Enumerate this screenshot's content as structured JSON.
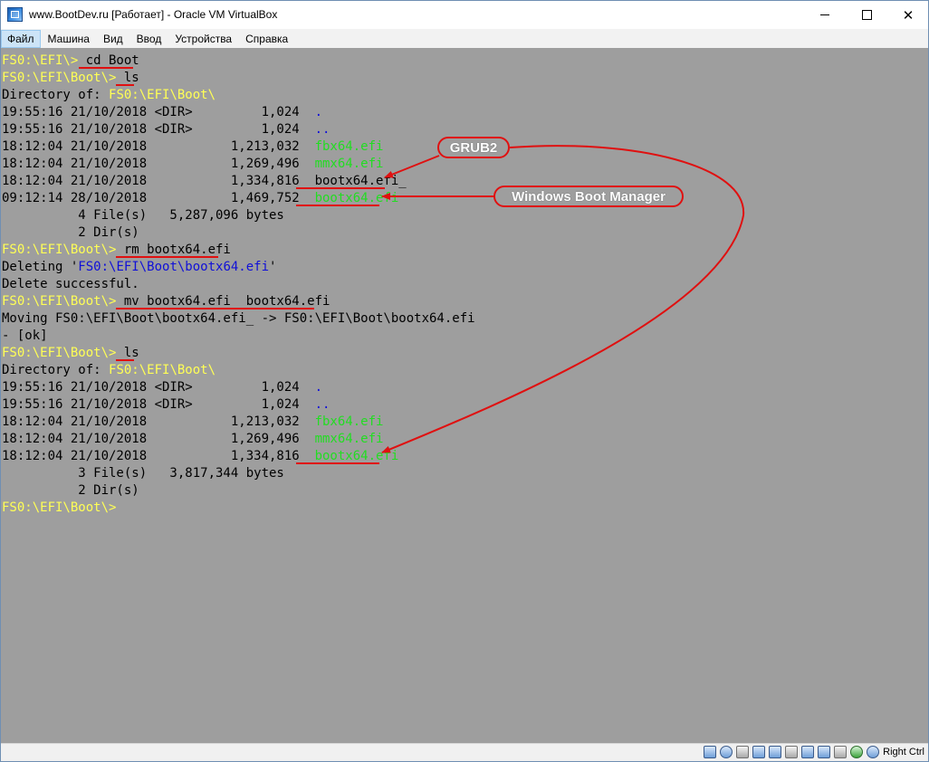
{
  "window": {
    "title": "www.BootDev.ru [Работает] - Oracle VM VirtualBox",
    "controls": {
      "minimize": "—",
      "maximize": "☐",
      "close": "✕"
    }
  },
  "menu": [
    {
      "label": "Файл",
      "active": true
    },
    {
      "label": "Машина"
    },
    {
      "label": "Вид"
    },
    {
      "label": "Ввод"
    },
    {
      "label": "Устройства"
    },
    {
      "label": "Справка"
    }
  ],
  "console": {
    "lines": [
      [
        [
          "FS0:\\EFI\\> ",
          "prompt"
        ],
        [
          "cd Boot",
          "black"
        ]
      ],
      [
        [
          "FS0:\\EFI\\Boot\\> ",
          "prompt"
        ],
        [
          "ls",
          "black"
        ]
      ],
      [
        [
          "Directory of: ",
          "black"
        ],
        [
          "FS0:\\EFI\\Boot\\",
          "prompt"
        ]
      ],
      [
        [
          "19:55:16 21/10/2018 <DIR>         1,024  ",
          "black"
        ],
        [
          ".",
          "blue"
        ]
      ],
      [
        [
          "19:55:16 21/10/2018 <DIR>         1,024  ",
          "black"
        ],
        [
          "..",
          "blue"
        ]
      ],
      [
        [
          "18:12:04 21/10/2018           1,213,032  ",
          "black"
        ],
        [
          "fbx64.efi",
          "green"
        ]
      ],
      [
        [
          "18:12:04 21/10/2018           1,269,496  ",
          "black"
        ],
        [
          "mmx64.efi",
          "green"
        ]
      ],
      [
        [
          "18:12:04 21/10/2018           1,334,816  ",
          "black"
        ],
        [
          "bootx64.efi_",
          "black"
        ]
      ],
      [
        [
          "09:12:14 28/10/2018           1,469,752  ",
          "black"
        ],
        [
          "bootx64.efi",
          "green"
        ]
      ],
      [
        [
          "          4 File(s)   5,287,096 bytes",
          "black"
        ]
      ],
      [
        [
          "          2 Dir(s)",
          "black"
        ]
      ],
      [
        [
          "FS0:\\EFI\\Boot\\> ",
          "prompt"
        ],
        [
          "rm bootx64.efi",
          "black"
        ]
      ],
      [
        [
          "Deleting '",
          "black"
        ],
        [
          "FS0:\\EFI\\Boot\\bootx64.efi",
          "blue"
        ],
        [
          "'",
          "black"
        ]
      ],
      [
        [
          "Delete successful.",
          "black"
        ]
      ],
      [
        [
          "FS0:\\EFI\\Boot\\> ",
          "prompt"
        ],
        [
          "mv bootx64.efi_ bootx64.efi",
          "black"
        ]
      ],
      [
        [
          "Moving FS0:\\EFI\\Boot\\bootx64.efi_ -> FS0:\\EFI\\Boot\\bootx64.efi",
          "black"
        ]
      ],
      [
        [
          "- [ok]",
          "black"
        ]
      ],
      [
        [
          "FS0:\\EFI\\Boot\\> ",
          "prompt"
        ],
        [
          "ls",
          "black"
        ]
      ],
      [
        [
          "Directory of: ",
          "black"
        ],
        [
          "FS0:\\EFI\\Boot\\",
          "prompt"
        ]
      ],
      [
        [
          "19:55:16 21/10/2018 <DIR>         1,024  ",
          "black"
        ],
        [
          ".",
          "blue"
        ]
      ],
      [
        [
          "19:55:16 21/10/2018 <DIR>         1,024  ",
          "black"
        ],
        [
          "..",
          "blue"
        ]
      ],
      [
        [
          "18:12:04 21/10/2018           1,213,032  ",
          "black"
        ],
        [
          "fbx64.efi",
          "green"
        ]
      ],
      [
        [
          "18:12:04 21/10/2018           1,269,496  ",
          "black"
        ],
        [
          "mmx64.efi",
          "green"
        ]
      ],
      [
        [
          "18:12:04 21/10/2018           1,334,816  ",
          "black"
        ],
        [
          "bootx64.efi",
          "green"
        ]
      ],
      [
        [
          "          3 File(s)   3,817,344 bytes",
          "black"
        ]
      ],
      [
        [
          "          2 Dir(s)",
          "black"
        ]
      ],
      [
        [
          "FS0:\\EFI\\Boot\\>",
          "prompt"
        ]
      ]
    ],
    "colors": {
      "prompt": "#ffff55",
      "blue": "#1010d8",
      "green": "#22dd22",
      "black": "#000000",
      "background": "#9e9e9e"
    }
  },
  "annotations": {
    "grub": "GRUB2",
    "windows_boot_manager": "Windows Boot Manager",
    "color": "#e01010"
  },
  "statusbar": {
    "host_key": "Right Ctrl",
    "icons": [
      "hard-disk-icon",
      "optical-drive-icon",
      "audio-icon",
      "network-icon",
      "usb-icon",
      "shared-folders-icon",
      "display-icon",
      "video-capture-icon",
      "cpu-icon",
      "mouse-integration-icon",
      "host-key-icon"
    ]
  }
}
